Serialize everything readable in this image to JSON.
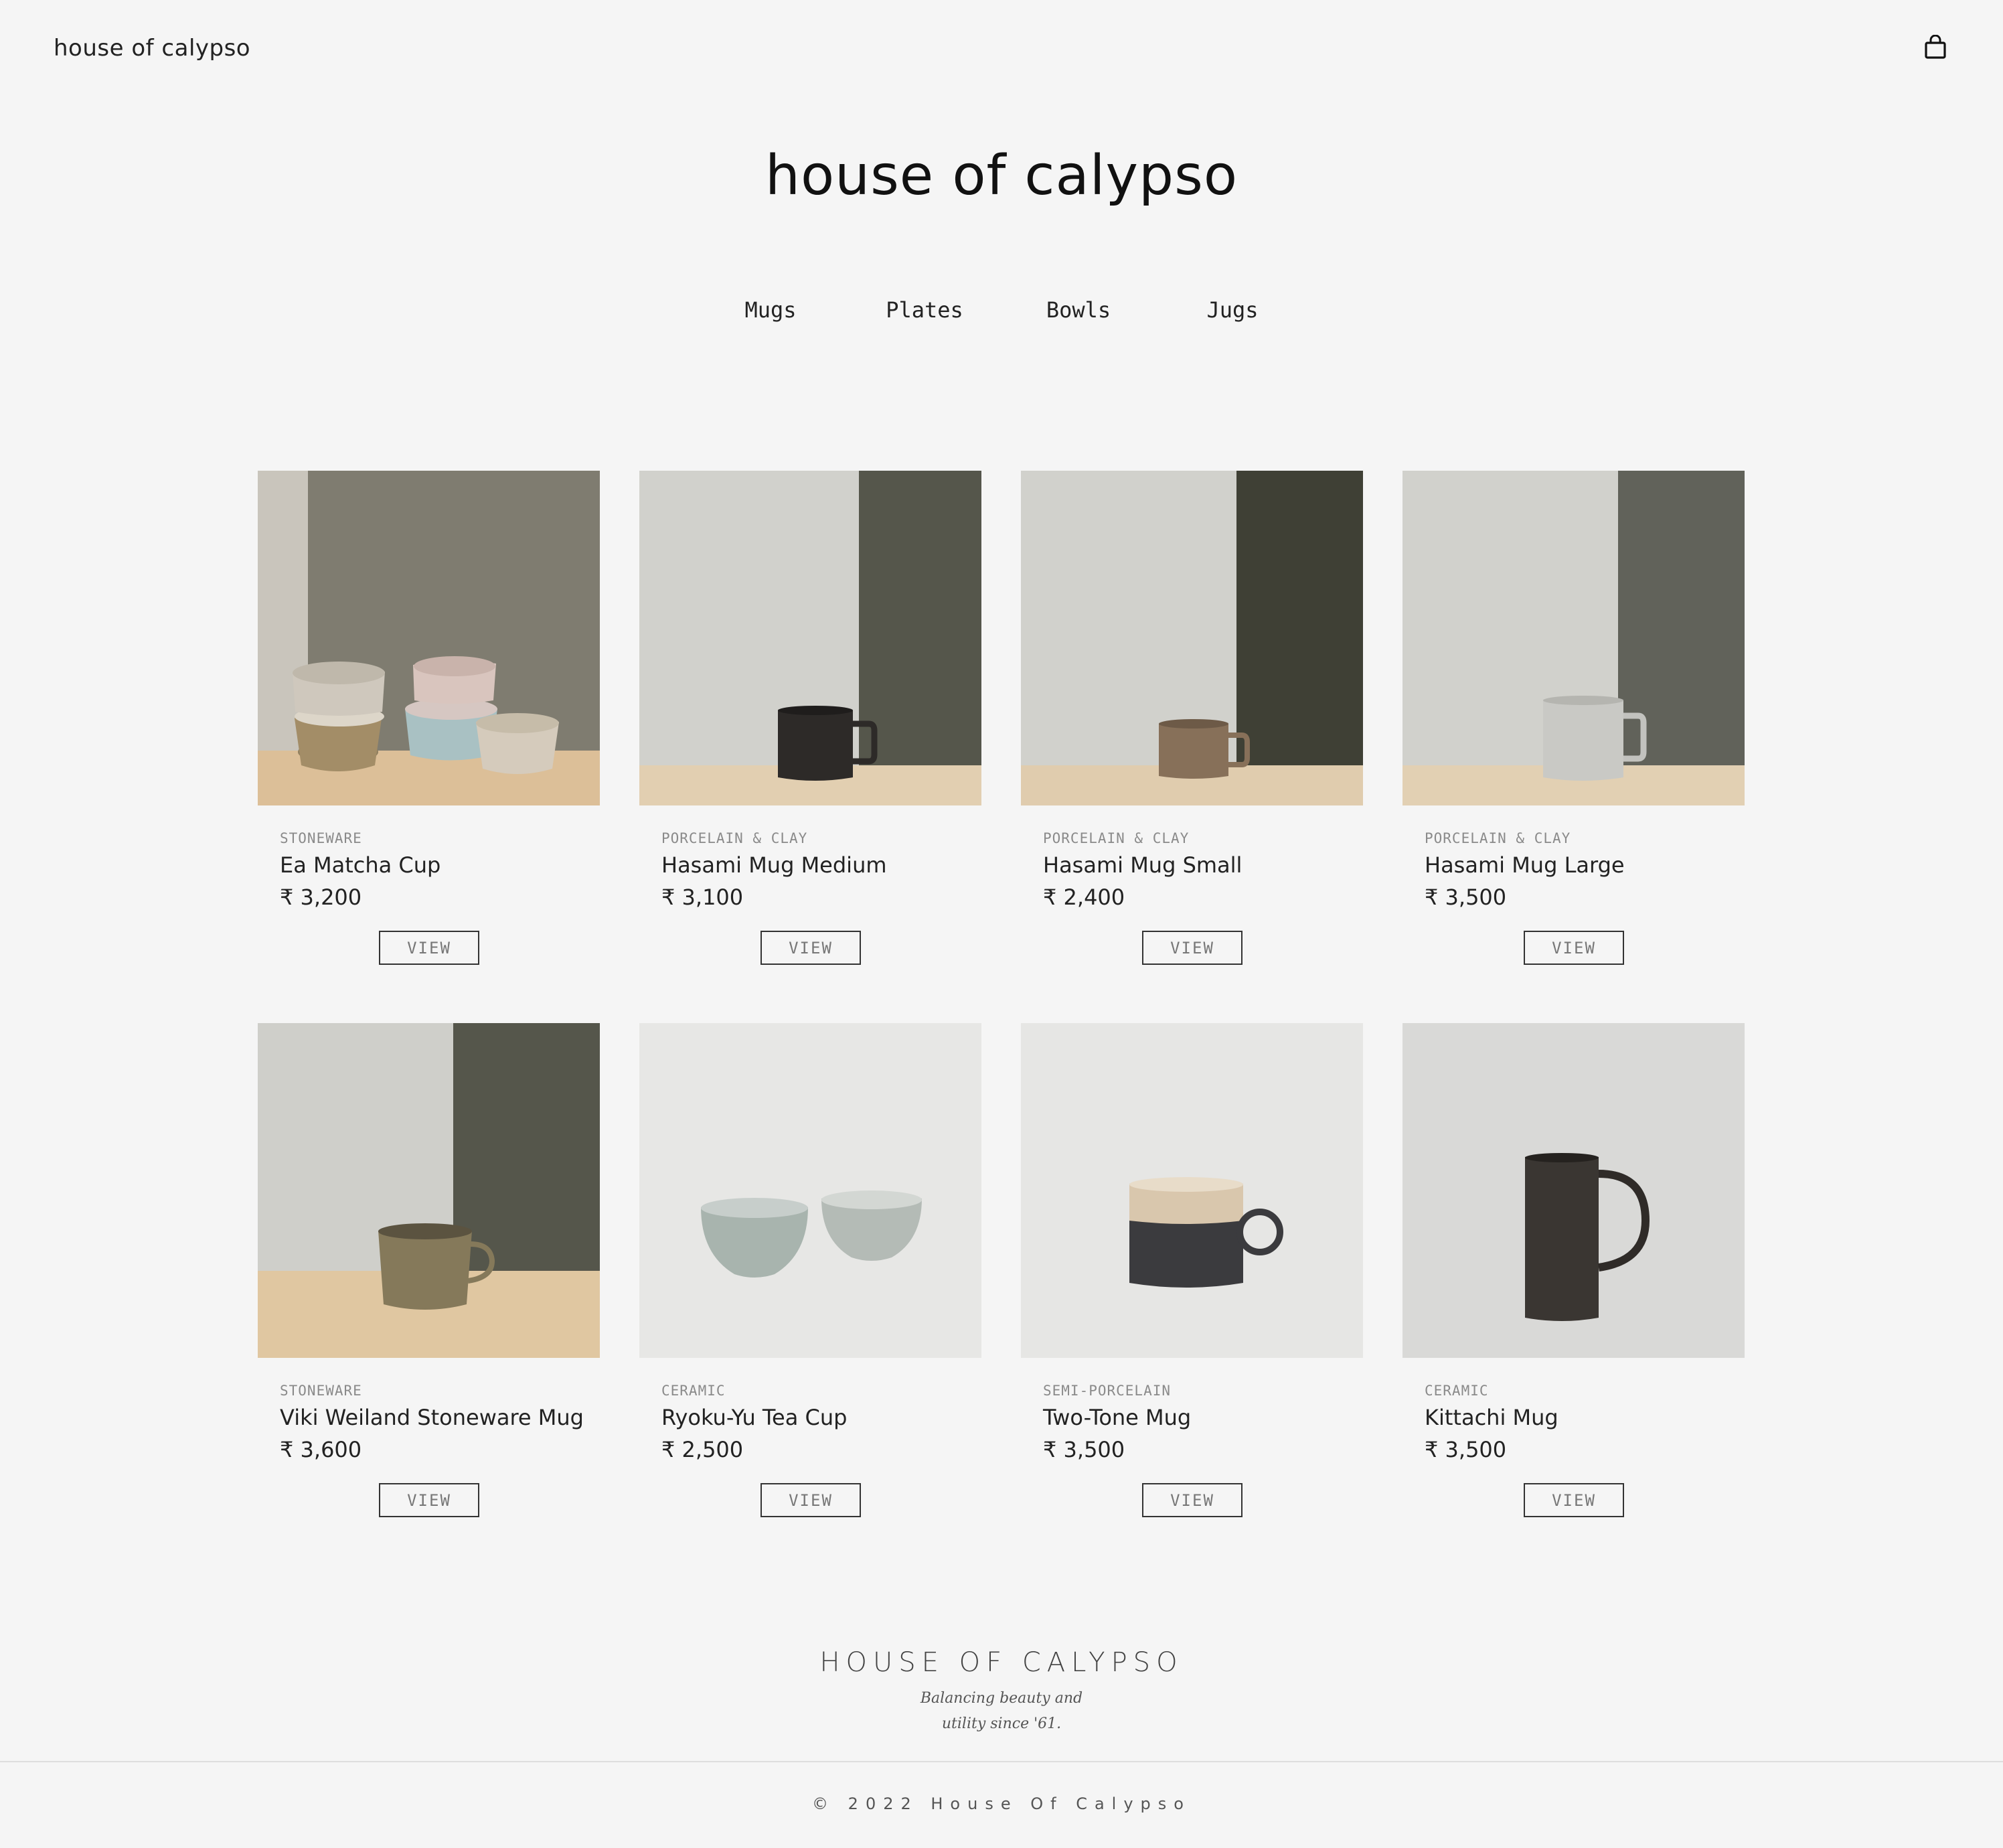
{
  "header": {
    "brand": "house of calypso",
    "cart_icon": "shopping-bag-icon"
  },
  "hero": {
    "title": "house of calypso"
  },
  "categories": [
    "Mugs",
    "Plates",
    "Bowls",
    "Jugs"
  ],
  "products": [
    {
      "material": "STONEWARE",
      "name": "Ea Matcha Cup",
      "price": "₹ 3,200",
      "button": "VIEW"
    },
    {
      "material": "PORCELAIN & CLAY",
      "name": "Hasami Mug Medium",
      "price": "₹ 3,100",
      "button": "VIEW"
    },
    {
      "material": "PORCELAIN & CLAY",
      "name": "Hasami Mug Small",
      "price": "₹ 2,400",
      "button": "VIEW"
    },
    {
      "material": "PORCELAIN & CLAY",
      "name": "Hasami Mug Large",
      "price": "₹ 3,500",
      "button": "VIEW"
    },
    {
      "material": "STONEWARE",
      "name": "Viki Weiland Stoneware Mug",
      "price": "₹ 3,600",
      "button": "VIEW"
    },
    {
      "material": "CERAMIC",
      "name": "Ryoku-Yu Tea Cup",
      "price": "₹ 2,500",
      "button": "VIEW"
    },
    {
      "material": "SEMI-PORCELAIN",
      "name": "Two-Tone Mug",
      "price": "₹ 3,500",
      "button": "VIEW"
    },
    {
      "material": "CERAMIC",
      "name": "Kittachi Mug",
      "price": "₹ 3,500",
      "button": "VIEW"
    }
  ],
  "footer": {
    "brand": "HOUSE OF CALYPSO",
    "tagline_line1": "Balancing beauty and",
    "tagline_line2": "utility since '61.",
    "copyright": "© 2022 House Of Calypso"
  }
}
